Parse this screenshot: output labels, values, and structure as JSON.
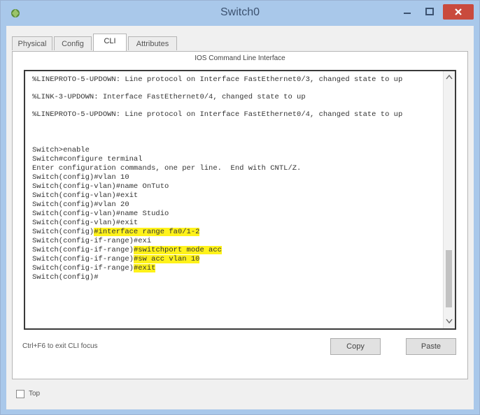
{
  "window": {
    "title": "Switch0",
    "accent": "#a9c8ea",
    "close_color": "#c94a3d"
  },
  "tabs": [
    {
      "label": "Physical"
    },
    {
      "label": "Config"
    },
    {
      "label": "CLI",
      "active": true
    },
    {
      "label": "Attributes"
    }
  ],
  "panel": {
    "heading": "IOS Command Line Interface"
  },
  "terminal": {
    "lines": [
      "%LINEPROTO-5-UPDOWN: Line protocol on Interface FastEthernet0/3, changed state to up",
      "%LINK-3-UPDOWN: Interface FastEthernet0/4, changed state to up",
      "%LINEPROTO-5-UPDOWN: Line protocol on Interface FastEthernet0/4, changed state to up",
      "Switch>enable",
      "Switch#configure terminal",
      "Enter configuration commands, one per line.  End with CNTL/Z.",
      "Switch(config)#vlan 10",
      "Switch(config-vlan)#name OnTuto",
      "Switch(config-vlan)#exit",
      "Switch(config)#vlan 20",
      "Switch(config-vlan)#name Studio",
      "Switch(config-vlan)#exit",
      {
        "prompt": "Switch(config)",
        "cmd": "#interface range fa0/1-2"
      },
      "Switch(config-if-range)#exi",
      {
        "prompt": "Switch(config-if-range)",
        "cmd": "#switchport mode acc"
      },
      {
        "prompt": "Switch(config-if-range)",
        "cmd": "#sw acc vlan 10"
      },
      {
        "prompt": "Switch(config-if-range)",
        "cmd": "#exit"
      },
      "Switch(config)#"
    ],
    "highlight_color": "#fff21a"
  },
  "footer": {
    "hint": "Ctrl+F6 to exit CLI focus",
    "copy_label": "Copy",
    "paste_label": "Paste",
    "top_label": "Top"
  }
}
